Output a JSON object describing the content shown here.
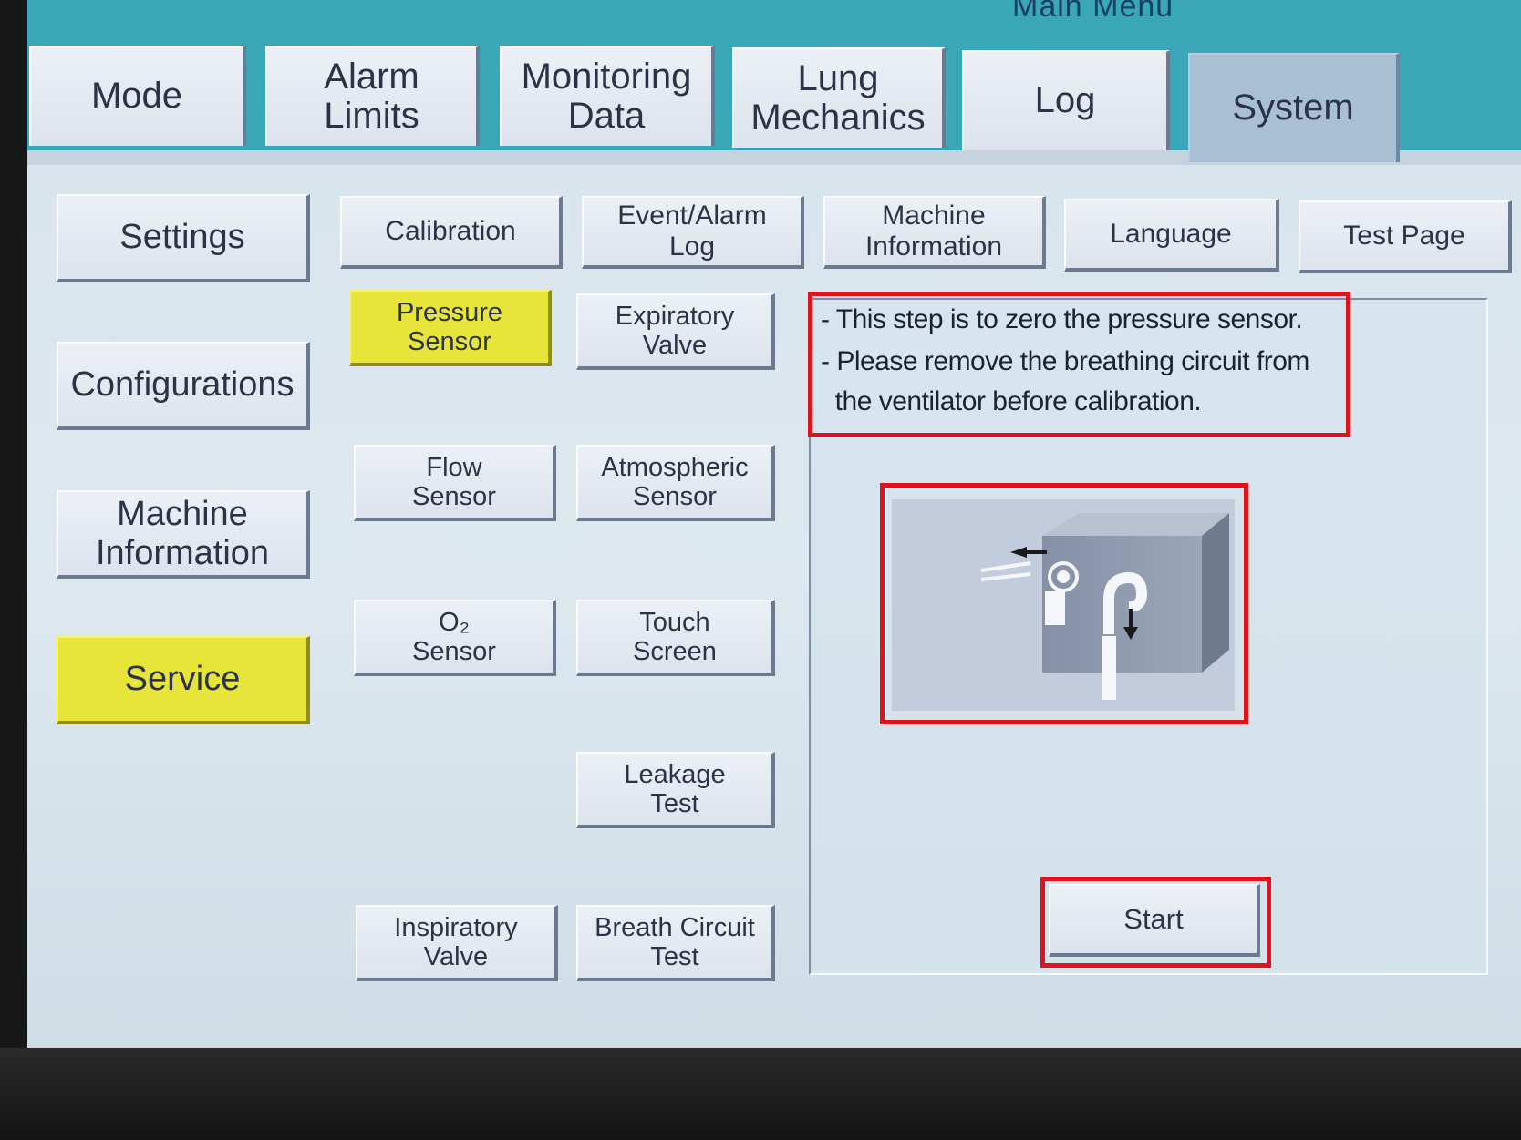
{
  "header": {
    "title": "Main Menu"
  },
  "tabs": [
    {
      "label": "Mode",
      "active": false
    },
    {
      "label": "Alarm\nLimits",
      "active": false
    },
    {
      "label": "Monitoring\nData",
      "active": false
    },
    {
      "label": "Lung\nMechanics",
      "active": false
    },
    {
      "label": "Log",
      "active": false
    },
    {
      "label": "System",
      "active": true
    }
  ],
  "sidebar": {
    "items": [
      {
        "label": "Settings",
        "selected": false
      },
      {
        "label": "Configurations",
        "selected": false
      },
      {
        "label": "Machine\nInformation",
        "selected": false
      },
      {
        "label": "Service",
        "selected": true
      }
    ]
  },
  "subtabs": [
    {
      "label": "Calibration"
    },
    {
      "label": "Event/Alarm\nLog"
    },
    {
      "label": "Machine\nInformation"
    },
    {
      "label": "Language"
    },
    {
      "label": "Test Page"
    }
  ],
  "service_buttons": [
    {
      "label": "Pressure\nSensor",
      "selected": true
    },
    {
      "label": "Expiratory\nValve",
      "selected": false
    },
    {
      "label": "Flow\nSensor",
      "selected": false
    },
    {
      "label": "Atmospheric\nSensor",
      "selected": false
    },
    {
      "label": "O₂\nSensor",
      "selected": false
    },
    {
      "label": "Touch\nScreen",
      "selected": false
    },
    {
      "label": "Leakage\nTest",
      "selected": false
    },
    {
      "label": "Inspiratory\nValve",
      "selected": false
    },
    {
      "label": "Breath Circuit\nTest",
      "selected": false
    }
  ],
  "panel": {
    "instructions": [
      "- This step is to zero the pressure sensor.",
      "- Please remove the breathing circuit from",
      "  the ventilator before calibration."
    ],
    "illustration_icon": "ventilator-port-disconnect-icon",
    "start_label": "Start"
  },
  "colors": {
    "tab_bar": "#3aa7b8",
    "selected_yellow": "#e8e53a",
    "highlight_red": "#e0121c",
    "background": "#d7e3ec"
  }
}
